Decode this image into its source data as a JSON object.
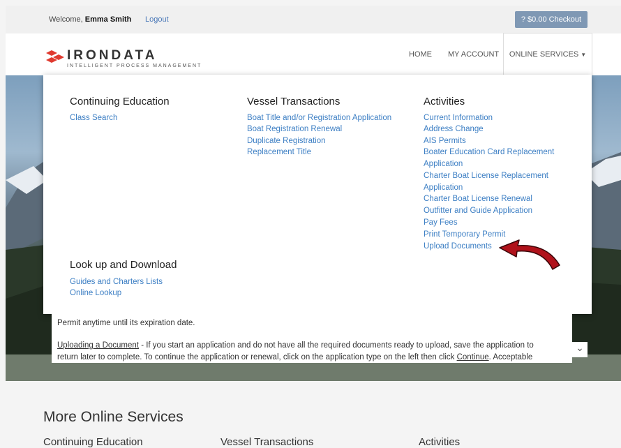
{
  "topbar": {
    "welcome_prefix": "Welcome, ",
    "user_name": "Emma Smith",
    "logout_label": "Logout",
    "checkout_label": "?  $0.00  Checkout"
  },
  "header": {
    "logo_text": "IRONDATA",
    "logo_tagline": "INTELLIGENT PROCESS MANAGEMENT",
    "nav": {
      "home": "HOME",
      "my_account": "MY ACCOUNT",
      "online_services": "ONLINE SERVICES"
    }
  },
  "dropdown": {
    "continuing_education": {
      "title": "Continuing Education",
      "links": [
        "Class Search"
      ]
    },
    "vessel_transactions": {
      "title": "Vessel Transactions",
      "links": [
        "Boat Title and/or Registration Application",
        "Boat Registration Renewal",
        "Duplicate Registration",
        "Replacement Title"
      ]
    },
    "activities": {
      "title": "Activities",
      "links": [
        "Current Information",
        "Address Change",
        "AIS Permits",
        "Boater Education Card Replacement",
        "Application",
        "Charter Boat License Replacement",
        "Application",
        "Charter Boat License Renewal",
        "Outfitter and Guide Application",
        "Pay Fees",
        "Print Temporary Permit",
        "Upload Documents"
      ]
    },
    "lookup": {
      "title": "Look up and Download",
      "links": [
        "Guides and Charters Lists",
        "Online Lookup"
      ]
    }
  },
  "content": {
    "line1": "Permit anytime until its expiration date.",
    "upload_heading": "Uploading a Document",
    "line2_rest": " - If you start an application and do not have all the required documents ready to upload, save the application to",
    "line3_a": "return later to complete. To continue the application or renewal, click on the application type on the left then click ",
    "line3_link": "Continue",
    "line3_b": ". Acceptable"
  },
  "more": {
    "title": "More Online Services",
    "columns": [
      "Continuing Education",
      "Vessel Transactions",
      "Activities"
    ]
  },
  "colors": {
    "link": "#3d7fc4",
    "checkout_bg": "#7f98b4",
    "logo_red": "#e03a2f"
  }
}
